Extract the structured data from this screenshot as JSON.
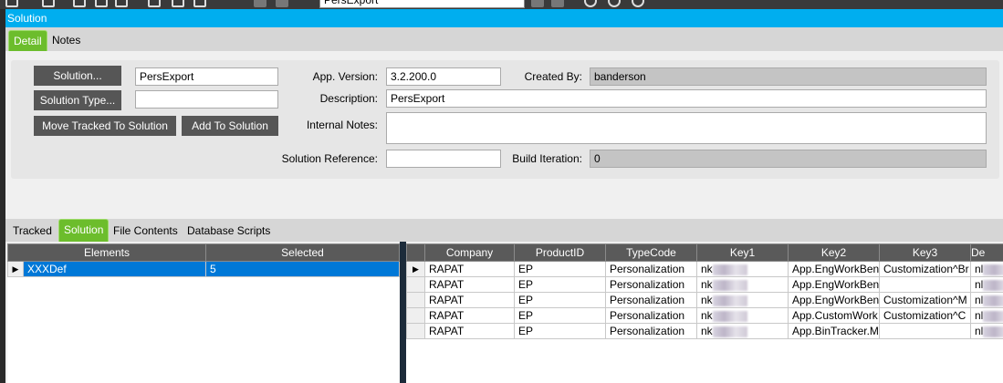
{
  "toolbar": {
    "combo_value": "PersExport"
  },
  "window": {
    "title": "Solution"
  },
  "top_tabs": [
    {
      "label": "Detail",
      "active": true
    },
    {
      "label": "Notes",
      "active": false
    }
  ],
  "form": {
    "solution_button": "Solution...",
    "solution_value": "PersExport",
    "solution_type_button": "Solution Type...",
    "solution_type_value": "",
    "move_tracked_button": "Move Tracked To Solution",
    "add_to_solution_button": "Add To Solution",
    "app_version_label": "App. Version:",
    "app_version_value": "3.2.200.0",
    "created_by_label": "Created By:",
    "created_by_value": "banderson",
    "description_label": "Description:",
    "description_value": "PersExport",
    "internal_notes_label": "Internal Notes:",
    "internal_notes_value": "",
    "solution_reference_label": "Solution Reference:",
    "solution_reference_value": "",
    "build_iteration_label": "Build Iteration:",
    "build_iteration_value": "0"
  },
  "bottom_tabs": [
    {
      "label": "Tracked"
    },
    {
      "label": "Solution",
      "active": true
    },
    {
      "label": "File Contents"
    },
    {
      "label": "Database Scripts"
    }
  ],
  "elements_grid": {
    "headers": [
      "Elements",
      "Selected"
    ],
    "rows": [
      [
        "XXXDef",
        "5"
      ]
    ]
  },
  "detail_grid": {
    "headers": [
      "Company",
      "ProductID",
      "TypeCode",
      "Key1",
      "Key2",
      "Key3",
      "De"
    ],
    "rows": [
      [
        "RAPAT",
        "EP",
        "Personalization",
        "nk",
        "App.EngWorkBen",
        "Customization^Br",
        "nl"
      ],
      [
        "RAPAT",
        "EP",
        "Personalization",
        "nk",
        "App.EngWorkBen",
        "",
        "nl"
      ],
      [
        "RAPAT",
        "EP",
        "Personalization",
        "nk",
        "App.EngWorkBen",
        "Customization^M",
        "nl"
      ],
      [
        "RAPAT",
        "EP",
        "Personalization",
        "nk",
        "App.CustomWork",
        "Customization^C",
        "nl"
      ],
      [
        "RAPAT",
        "EP",
        "Personalization",
        "nk",
        "App.BinTracker.M",
        "",
        "nl"
      ]
    ]
  }
}
